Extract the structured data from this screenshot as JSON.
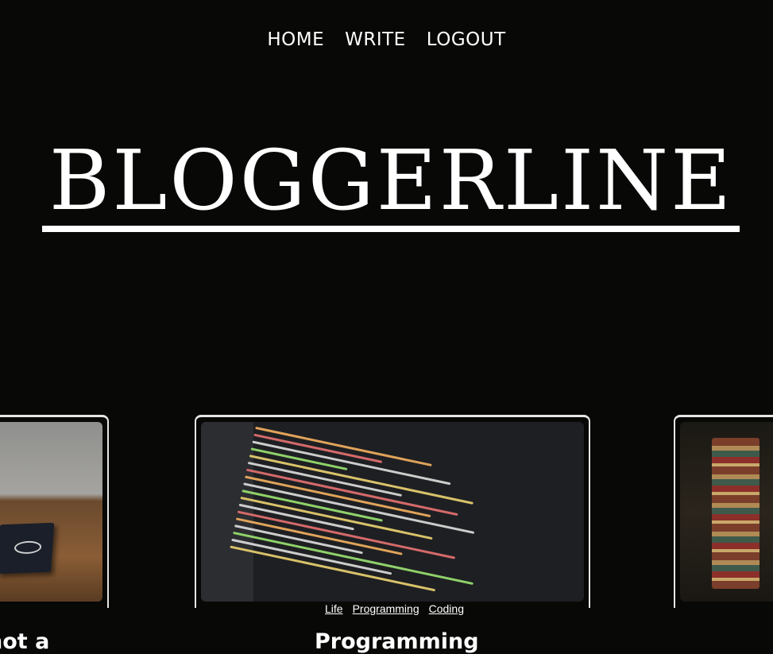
{
  "nav": {
    "items": [
      "HOME",
      "WRITE",
      "LOGOUT"
    ]
  },
  "header": {
    "title": "BLOGGERLINE"
  },
  "posts": [
    {
      "title": "not a",
      "image": "notebook-on-desk-image"
    },
    {
      "title": "Programming",
      "image": "code-editor-image",
      "categories": [
        "Life",
        "Programming",
        "Coding"
      ]
    },
    {
      "title": "",
      "image": "book-stack-image"
    }
  ]
}
